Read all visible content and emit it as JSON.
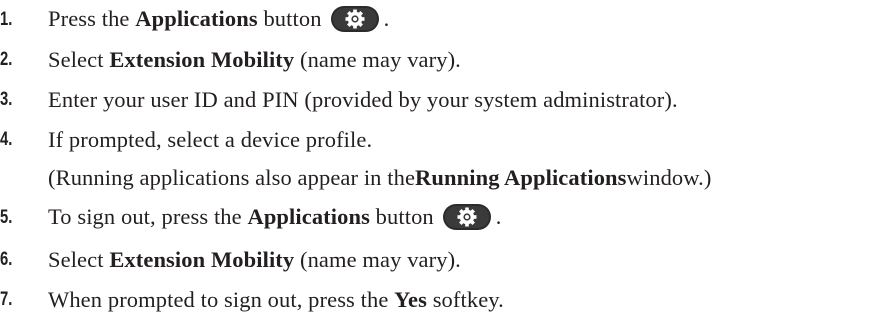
{
  "steps": [
    {
      "num": "1.",
      "parts": [
        "Press the ",
        "Applications",
        " button",
        "."
      ]
    },
    {
      "num": "2.",
      "parts": [
        "Select ",
        "Extension Mobility",
        " (name may vary)."
      ]
    },
    {
      "num": "3.",
      "text": "Enter your user ID and PIN (provided by your system administrator)."
    },
    {
      "num": "4.",
      "text": "If prompted, select a device profile.",
      "cont_parts": [
        "(Running applications also appear in the ",
        "Running Applications",
        " window.)"
      ]
    },
    {
      "num": "5.",
      "parts": [
        "To sign out, press the ",
        "Applications",
        " button",
        "."
      ]
    },
    {
      "num": "6.",
      "parts": [
        "Select ",
        "Extension Mobility",
        " (name may vary)."
      ]
    },
    {
      "num": "7.",
      "parts": [
        "When prompted to sign out, press the ",
        "Yes",
        " softkey."
      ]
    }
  ],
  "icons": {
    "applications_button": "gear-icon"
  }
}
